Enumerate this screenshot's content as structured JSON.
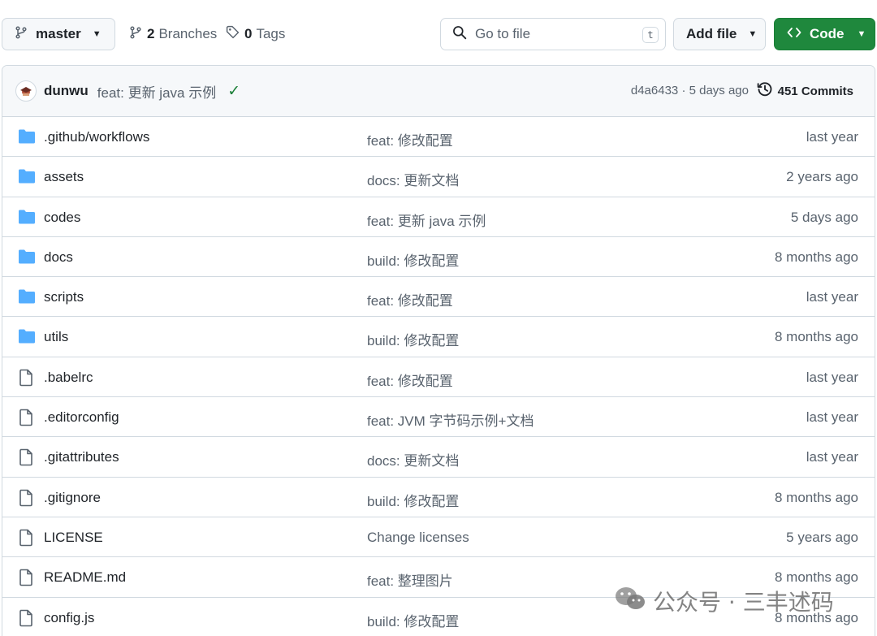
{
  "toolbar": {
    "branch_name": "master",
    "branches_count": "2",
    "branches_label": "Branches",
    "tags_count": "0",
    "tags_label": "Tags",
    "search_placeholder": "Go to file",
    "search_shortcut": "t",
    "add_file_label": "Add file",
    "code_label": "Code"
  },
  "latest_commit": {
    "author": "dunwu",
    "message": "feat: 更新 java 示例",
    "meta": "d4a6433 · 5 days ago",
    "commits_count_label": "451 Commits"
  },
  "files": [
    {
      "name": ".github/workflows",
      "type": "folder",
      "message": "feat: 修改配置",
      "date": "last year"
    },
    {
      "name": "assets",
      "type": "folder",
      "message": "docs: 更新文档",
      "date": "2 years ago"
    },
    {
      "name": "codes",
      "type": "folder",
      "message": "feat: 更新 java 示例",
      "date": "5 days ago"
    },
    {
      "name": "docs",
      "type": "folder",
      "message": "build: 修改配置",
      "date": "8 months ago"
    },
    {
      "name": "scripts",
      "type": "folder",
      "message": "feat: 修改配置",
      "date": "last year"
    },
    {
      "name": "utils",
      "type": "folder",
      "message": "build: 修改配置",
      "date": "8 months ago"
    },
    {
      "name": ".babelrc",
      "type": "file",
      "message": "feat: 修改配置",
      "date": "last year"
    },
    {
      "name": ".editorconfig",
      "type": "file",
      "message": "feat: JVM 字节码示例+文档",
      "date": "last year"
    },
    {
      "name": ".gitattributes",
      "type": "file",
      "message": "docs: 更新文档",
      "date": "last year"
    },
    {
      "name": ".gitignore",
      "type": "file",
      "message": "build: 修改配置",
      "date": "8 months ago"
    },
    {
      "name": "LICENSE",
      "type": "file",
      "message": "Change licenses",
      "date": "5 years ago"
    },
    {
      "name": "README.md",
      "type": "file",
      "message": "feat: 整理图片",
      "date": "8 months ago"
    },
    {
      "name": "config.js",
      "type": "file",
      "message": "build: 修改配置",
      "date": "8 months ago"
    }
  ],
  "watermark": "公众号 · 三丰述码",
  "colors": {
    "folder": "#54aeff",
    "accent_green": "#1f883d",
    "border": "#d1d9e0",
    "muted_text": "#59636e"
  }
}
